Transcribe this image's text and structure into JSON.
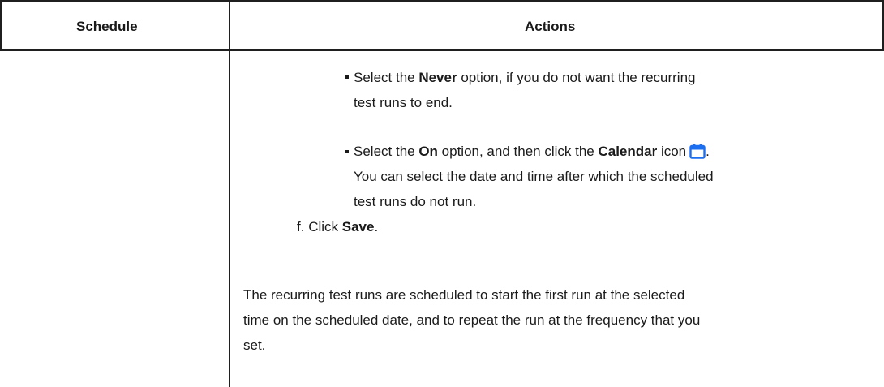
{
  "table": {
    "headers": {
      "schedule": "Schedule",
      "actions": "Actions"
    }
  },
  "content": {
    "bullet_never": {
      "prefix": "Select the ",
      "bold": "Never",
      "suffix_line1": " option, if you do not want the recurring",
      "line2": "test runs to end."
    },
    "bullet_on": {
      "prefix": "Select the ",
      "bold1": "On",
      "middle": " option, and then click the ",
      "bold2": "Calendar",
      "after": " icon",
      "icon": "calendar-icon",
      "end": ".",
      "line2": "You can select the date and time after which the scheduled",
      "line3": "test runs do not run."
    },
    "step_f": {
      "marker": "f.",
      "text_prefix": "Click ",
      "bold": "Save",
      "end": "."
    },
    "result_paragraph": {
      "line1": "The recurring test runs are scheduled to start the first run at the selected",
      "line2": "time on the scheduled date, and to repeat the run at the frequency that you",
      "line3": "set."
    }
  },
  "colors": {
    "calendar_icon": "#1d6ff2"
  }
}
